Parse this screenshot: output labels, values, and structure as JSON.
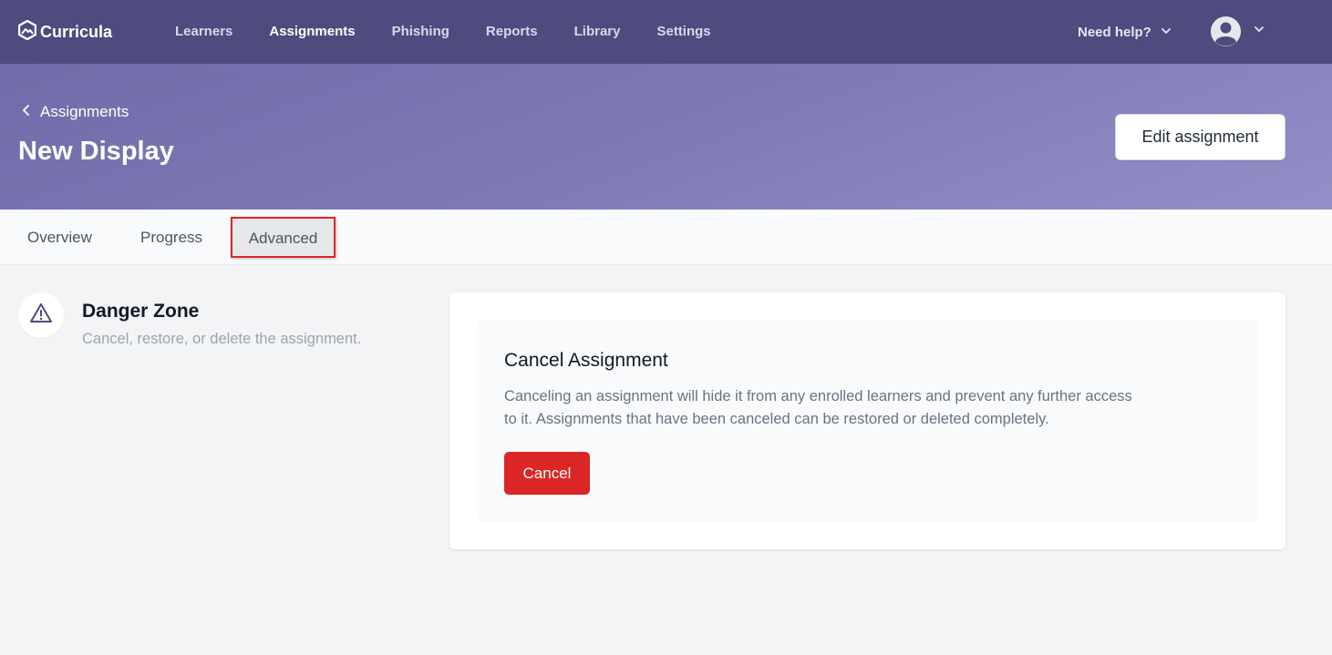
{
  "nav": {
    "brand": "Curricula",
    "links": [
      {
        "label": "Learners"
      },
      {
        "label": "Assignments",
        "active": true
      },
      {
        "label": "Phishing"
      },
      {
        "label": "Reports"
      },
      {
        "label": "Library"
      },
      {
        "label": "Settings"
      }
    ],
    "help_label": "Need help?",
    "icons": {
      "brand": "curricula-logo-icon",
      "help_chevron": "chevron-down-icon",
      "avatar": "user-avatar-icon",
      "account_chevron": "chevron-down-icon"
    }
  },
  "header": {
    "back_label": "Assignments",
    "title": "New Display",
    "edit_button": "Edit assignment"
  },
  "tabs": [
    {
      "label": "Overview"
    },
    {
      "label": "Progress"
    },
    {
      "label": "Advanced",
      "selected": true
    }
  ],
  "danger_zone": {
    "icon": "warning-triangle-icon",
    "title": "Danger Zone",
    "subtitle": "Cancel, restore, or delete the assignment."
  },
  "cancel_section": {
    "title": "Cancel Assignment",
    "description": "Canceling an assignment will hide it from any enrolled learners and prevent any further access to it. Assignments that have been canceled can be restored or deleted completely.",
    "button": "Cancel"
  },
  "colors": {
    "nav_bg": "#4e4b7e",
    "header_gradient_start": "#706ca9",
    "header_gradient_end": "#9390c8",
    "danger": "#dc2626",
    "tab_highlight_border": "#dc2626"
  }
}
